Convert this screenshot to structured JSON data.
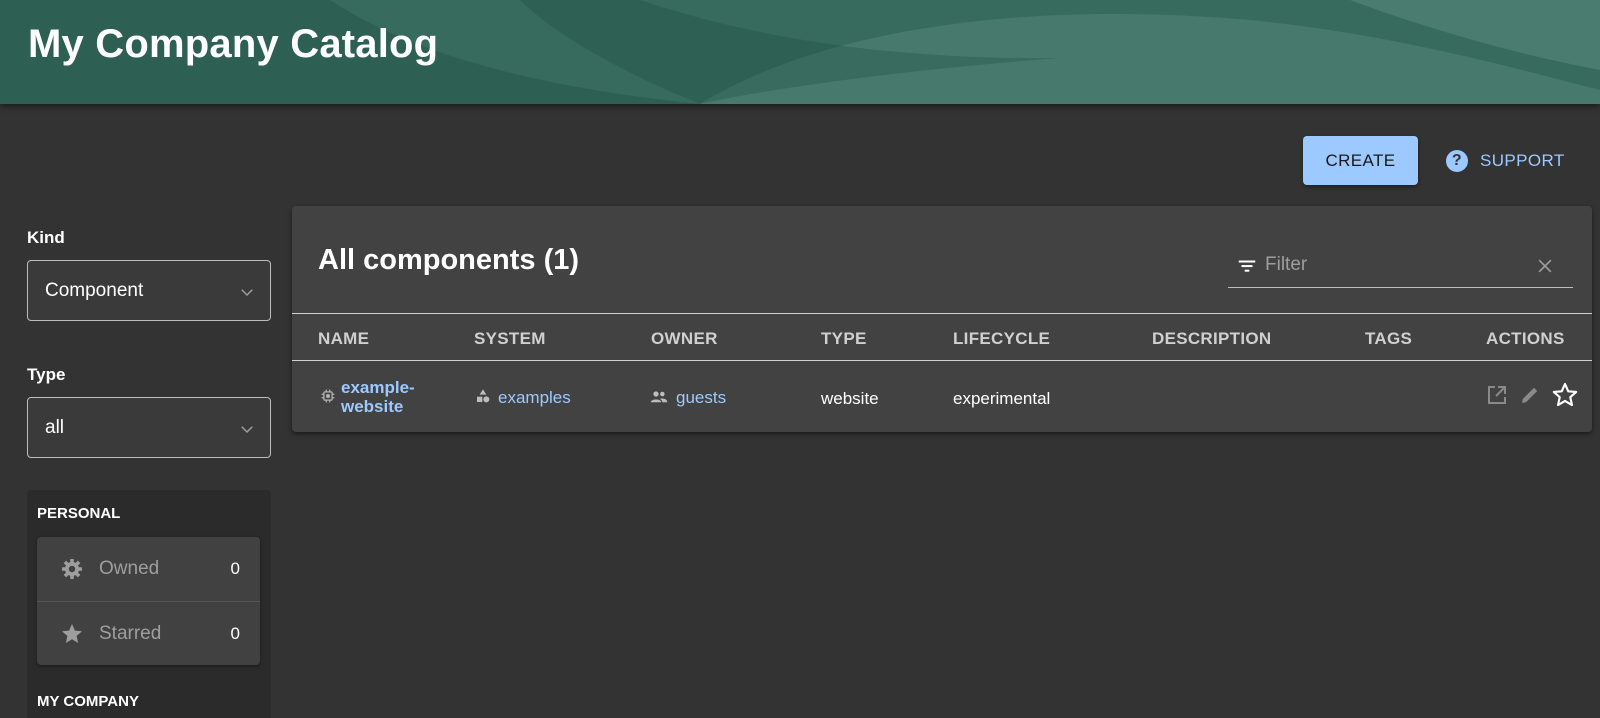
{
  "header": {
    "title": "My Company Catalog"
  },
  "toolbar": {
    "create_label": "CREATE",
    "support_label": "SUPPORT"
  },
  "sidebar": {
    "kind": {
      "label": "Kind",
      "value": "Component"
    },
    "type": {
      "label": "Type",
      "value": "all"
    },
    "personal": {
      "heading": "PERSONAL",
      "items": [
        {
          "label": "Owned",
          "count": "0",
          "icon": "gear-icon"
        },
        {
          "label": "Starred",
          "count": "0",
          "icon": "star-icon"
        }
      ]
    },
    "company_heading": "MY COMPANY"
  },
  "table": {
    "title": "All components (1)",
    "filter_placeholder": "Filter",
    "columns": [
      "NAME",
      "SYSTEM",
      "OWNER",
      "TYPE",
      "LIFECYCLE",
      "DESCRIPTION",
      "TAGS",
      "ACTIONS"
    ],
    "rows": [
      {
        "name": "example-website",
        "system": "examples",
        "owner": "guests",
        "type": "website",
        "lifecycle": "experimental",
        "description": "",
        "tags": ""
      }
    ]
  },
  "colors": {
    "header_bg": "#2d5f52",
    "page_bg": "#333333",
    "card_bg": "#424242",
    "accent": "#9cc9ff"
  }
}
